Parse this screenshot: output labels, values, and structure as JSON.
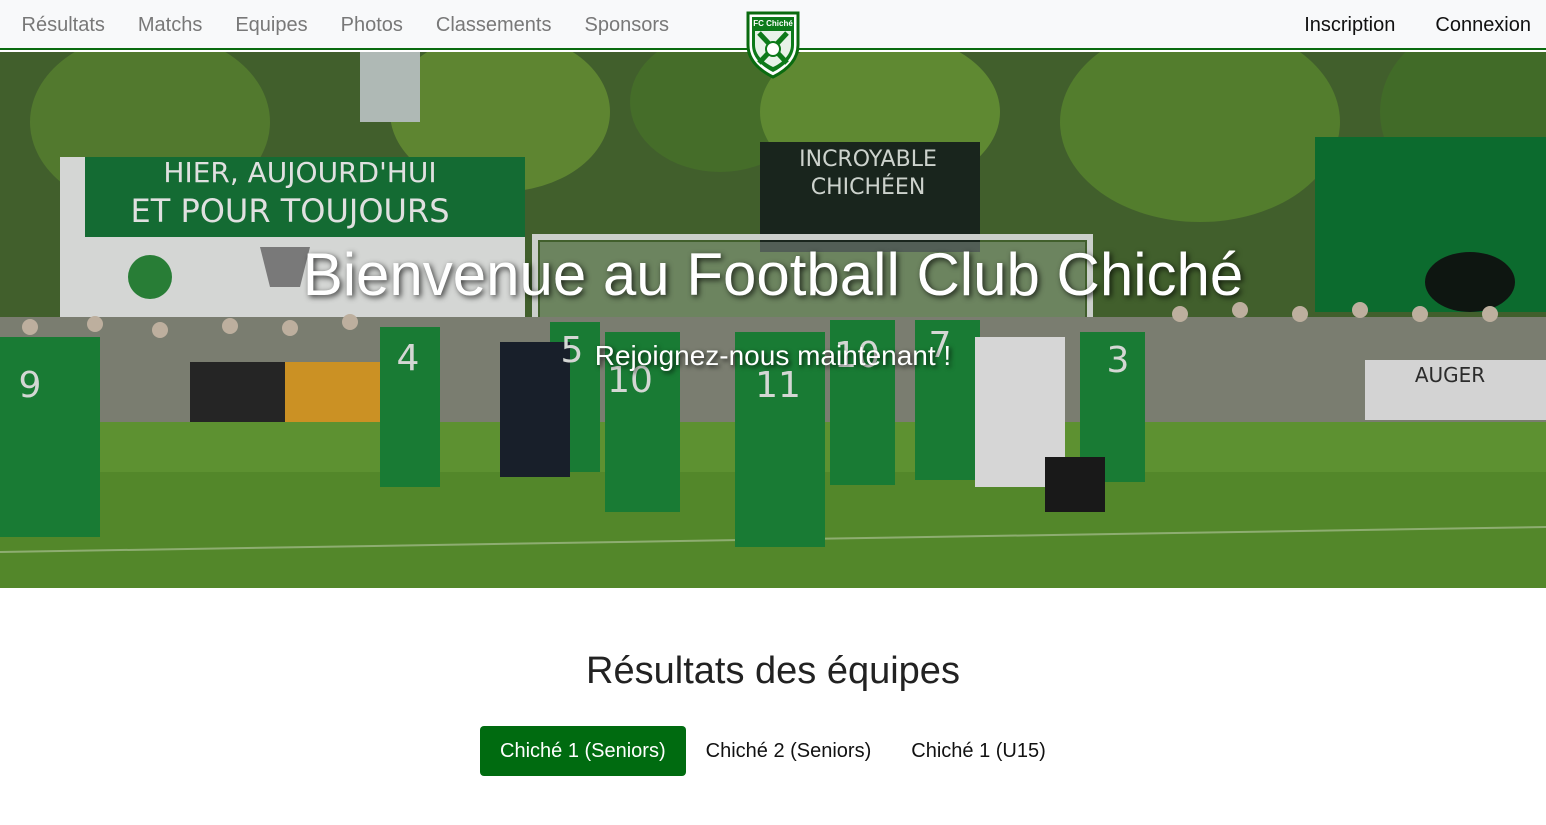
{
  "nav": {
    "left_items": [
      {
        "label": "Résultats"
      },
      {
        "label": "Matchs"
      },
      {
        "label": "Equipes"
      },
      {
        "label": "Photos"
      },
      {
        "label": "Classements"
      },
      {
        "label": "Sponsors"
      }
    ],
    "right_items": [
      {
        "label": "Inscription"
      },
      {
        "label": "Connexion"
      }
    ],
    "logo_text": "FC Chiché"
  },
  "hero": {
    "title": "Bienvenue au Football Club Chiché",
    "subtitle": "Rejoignez-nous maintenant !",
    "banner_text_1": "HIER, AUJOURD'HUI",
    "banner_text_2": "ET POUR TOUJOURS",
    "banner_text_3": "INCROYABLE",
    "banner_text_4": "CHICHÉEN",
    "sponsor_text": "AUGER",
    "jersey_numbers": [
      "9",
      "4",
      "5",
      "10",
      "11",
      "10",
      "7",
      "3"
    ]
  },
  "results": {
    "title": "Résultats des équipes",
    "tabs": [
      {
        "label": "Chiché 1 (Seniors)",
        "active": true
      },
      {
        "label": "Chiché 2 (Seniors)",
        "active": false
      },
      {
        "label": "Chiché 1 (U15)",
        "active": false
      }
    ]
  },
  "colors": {
    "brand_green": "#006b10",
    "nav_bg": "#f8f9fa",
    "nav_text": "#787878"
  }
}
